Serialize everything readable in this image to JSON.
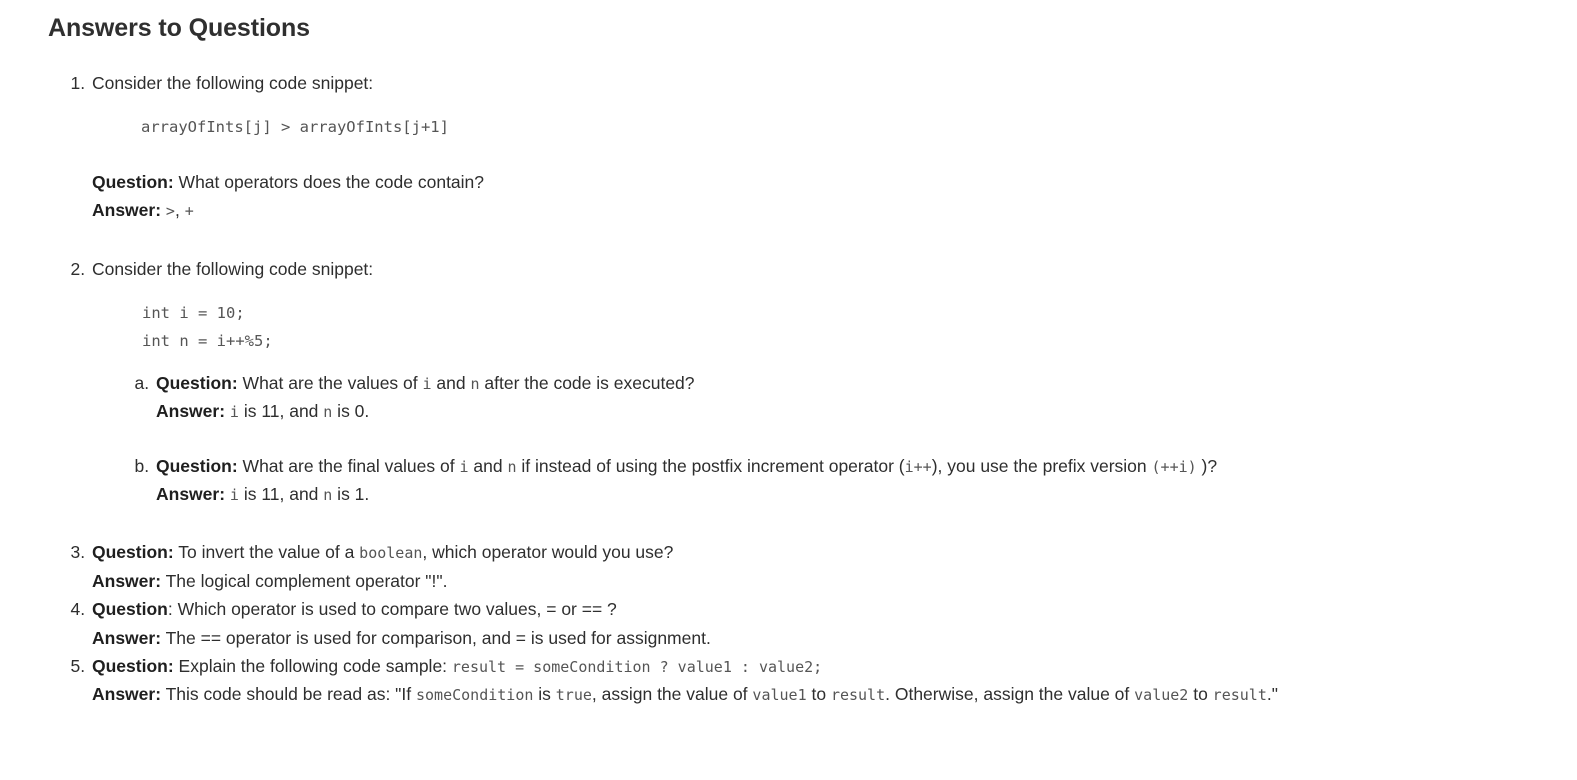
{
  "page": {
    "title": "Answers to Questions",
    "background_color": "#ffffff",
    "text_color": "#2e2e2e",
    "code_color": "#555555"
  },
  "labels": {
    "question": "Question:",
    "question_plain_colon": "Question",
    "answer": "Answer:",
    "colon": ":"
  },
  "items": [
    {
      "number": "1.",
      "lead": "Consider the following code snippet:",
      "code": "arrayOfInts[j] > arrayOfInts[j+1]",
      "question_text": "What operators does the code contain?",
      "answer_code_1": ">",
      "answer_sep": ",",
      "answer_code_2": "+"
    },
    {
      "number": "2.",
      "lead": "Consider the following code snippet:",
      "code": "int i = 10;\nint n = i++%5;",
      "sub": [
        {
          "marker": "a.",
          "q_part1": "What are the values of ",
          "q_code1": "i",
          "q_part2": " and ",
          "q_code2": "n",
          "q_part3": " after the code is executed?",
          "a_code1": "i",
          "a_part1": " is 11, and ",
          "a_code2": "n",
          "a_part2": " is 0."
        },
        {
          "marker": "b.",
          "q_part1": "What are the final values of ",
          "q_code1": "i",
          "q_part2": " and ",
          "q_code2": "n",
          "q_part3": " if instead of using the postfix increment operator (",
          "q_code3": "i++",
          "q_part4": "), you use the prefix version ",
          "q_code4": "(++i)",
          "q_part5": " )?",
          "a_code1": "i",
          "a_part1": " is 11, and ",
          "a_code2": "n",
          "a_part2": " is 1."
        }
      ]
    },
    {
      "number": "3.",
      "q_part1": "To invert the value of a ",
      "q_code1": "boolean",
      "q_part2": ", which operator would you use?",
      "a_text": "The logical complement operator \"!\"."
    },
    {
      "number": "4.",
      "q_part1": "Which operator is used to compare two values, = or == ?",
      "a_text": "The == operator is used for comparison, and = is used for assignment."
    },
    {
      "number": "5.",
      "q_part1": "Explain the following code sample: ",
      "q_code1": "result = someCondition ? value1 : value2;",
      "a_part1": "This code should be read as: \"If ",
      "a_code1": "someCondition",
      "a_part2": " is ",
      "a_code2": "true",
      "a_part3": ", assign the value of ",
      "a_code3": "value1",
      "a_part4": " to ",
      "a_code4": "result",
      "a_part5": ". Otherwise, assign the value of ",
      "a_code5": "value2",
      "a_part6": " to ",
      "a_code6": "result",
      "a_part7": ".\""
    }
  ]
}
